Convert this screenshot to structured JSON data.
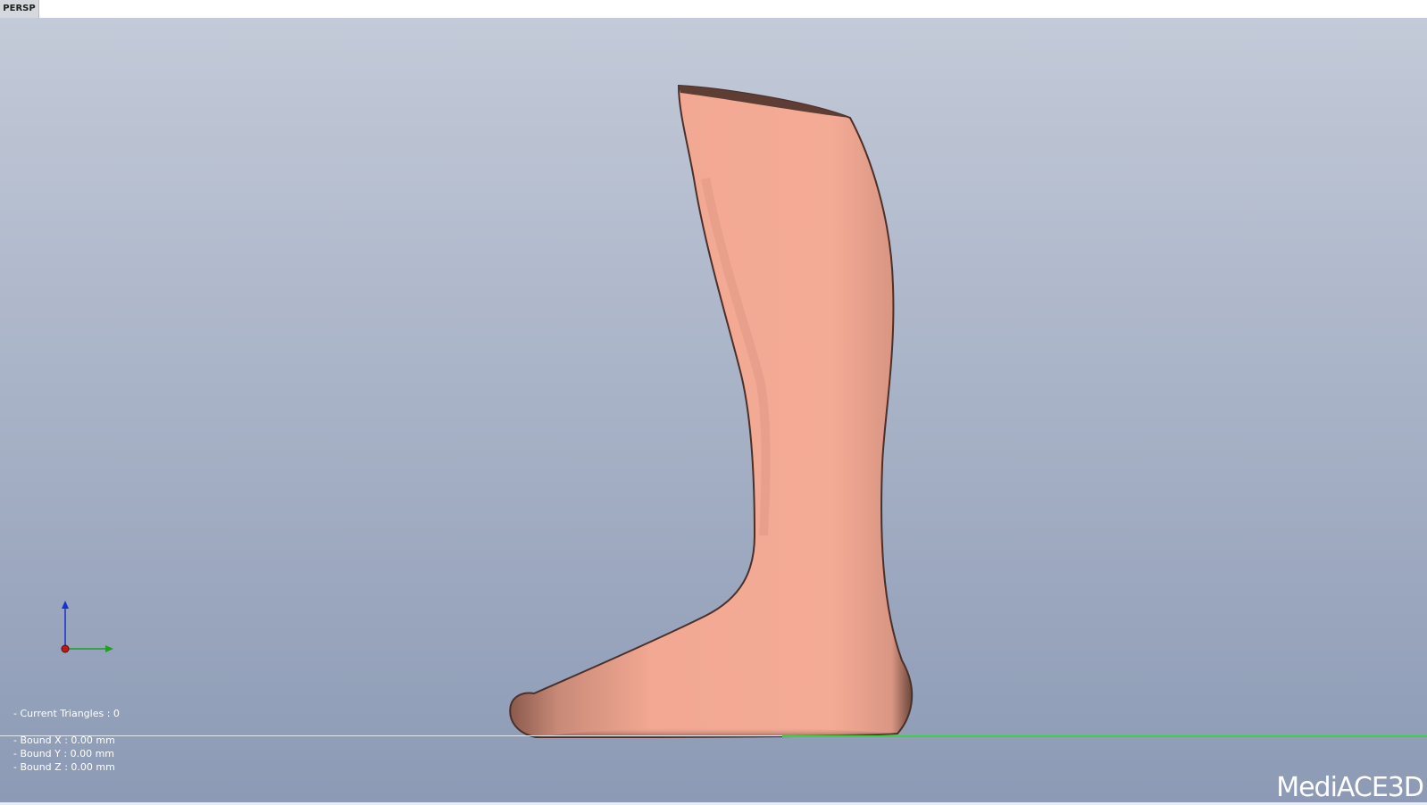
{
  "viewport": {
    "view_mode": "PERSP",
    "background_top": "#c3cad8",
    "background_bottom": "#8c9ab5",
    "model_color": "#f2a892"
  },
  "stats": {
    "triangles": "- Current Triangles : 0",
    "bound_x": "- Bound X : 0.00 mm",
    "bound_y": "- Bound Y : 0.00 mm",
    "bound_z": "- Bound Z : 0.00 mm"
  },
  "axes": {
    "x_color": "#1fa01f",
    "z_color": "#1a2fd0",
    "origin_color": "#c01818"
  },
  "logo": {
    "text": "MediACE3D"
  }
}
